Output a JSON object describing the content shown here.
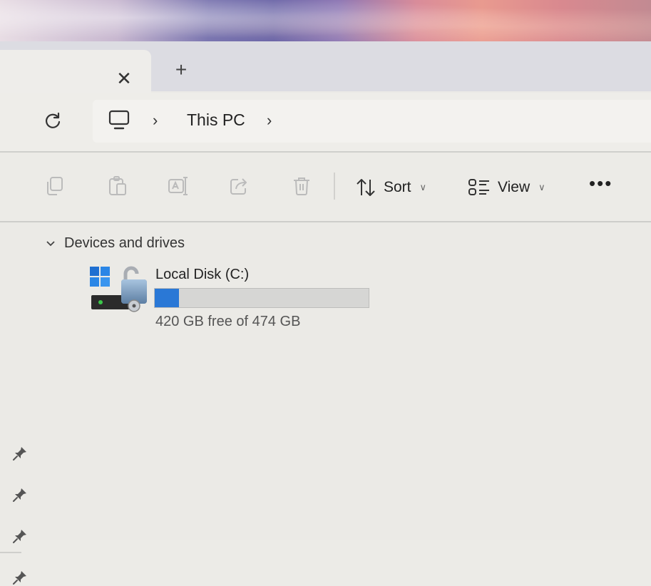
{
  "window": {
    "tab": {
      "close_glyph": "✕"
    },
    "new_tab_glyph": "+"
  },
  "address": {
    "refresh_icon": "refresh-icon",
    "location_icon": "this-pc-icon",
    "crumbs": [
      "This PC"
    ],
    "separator": "›"
  },
  "toolbar": {
    "icons": [
      "copy-icon",
      "paste-icon",
      "rename-icon",
      "share-icon",
      "delete-icon"
    ],
    "sort_label": "Sort",
    "view_label": "View",
    "more_label": "•••"
  },
  "content": {
    "group": {
      "label": "Devices and drives",
      "expanded": true
    },
    "drives": [
      {
        "name": "Local Disk (C:)",
        "space_text": "420 GB free of 474 GB",
        "used_fraction": 0.114,
        "bar_color": "#2a78d6"
      }
    ]
  },
  "sidebar": {
    "pinned_count": 4,
    "pin_icon": "pin-icon"
  },
  "colors": {
    "accent": "#2a78d6",
    "background": "#ecebe7"
  }
}
